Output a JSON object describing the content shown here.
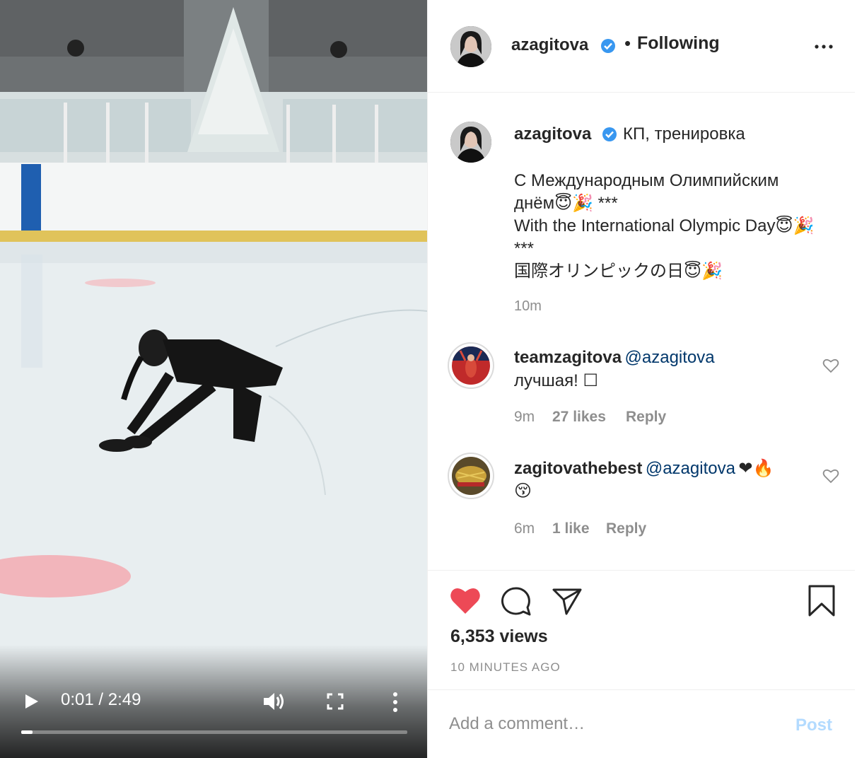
{
  "video": {
    "time_display": "0:01 / 2:49",
    "progress_fraction": 0.03
  },
  "post": {
    "author": "azagitova",
    "follow_status": "Following",
    "follow_dot": "•",
    "caption_first_line": "КП, тренировка",
    "caption_lines": [
      "С Международным Олимпийским",
      "днём😇🎉 ***",
      "With the International Olympic Day😇🎉",
      "***",
      "国際オリンピックの日😇🎉"
    ],
    "caption_time": "10m"
  },
  "comments": [
    {
      "username": "teamzagitova",
      "mention": "@azagitova",
      "text": "лучшая! ☐",
      "time": "9m",
      "likes": "27 likes",
      "reply": "Reply"
    },
    {
      "username": "zagitovathebest",
      "mention": "@azagitova",
      "text_inline": "❤🔥",
      "text": "😚",
      "time": "6m",
      "likes": "1 like",
      "reply": "Reply"
    }
  ],
  "stats": {
    "views": "6,353 views",
    "posted_ago": "10 MINUTES AGO"
  },
  "add_comment": {
    "placeholder": "Add a comment…",
    "post_label": "Post"
  },
  "colors": {
    "like_red": "#ed4956",
    "verified_blue": "#3897f0",
    "mention_blue": "#00376b",
    "post_disabled": "#b3dbff"
  },
  "icons": {
    "play": "play-icon",
    "volume": "volume-icon",
    "fullscreen": "fullscreen-icon",
    "more": "more-icon",
    "like": "heart-filled-icon",
    "comment": "comment-icon",
    "share": "share-icon",
    "save": "bookmark-icon"
  }
}
